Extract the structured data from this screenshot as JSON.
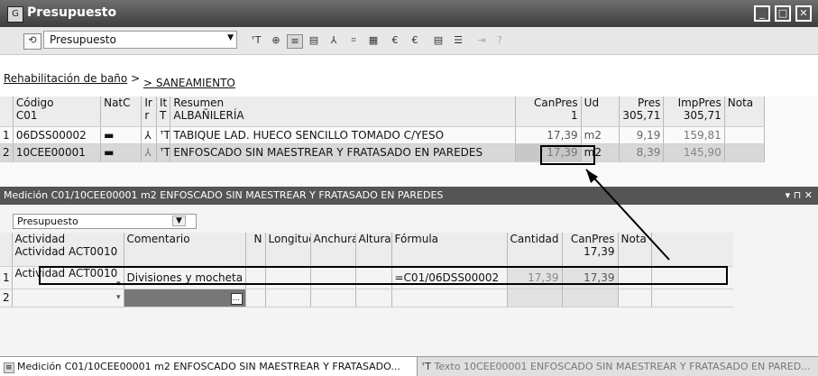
{
  "window": {
    "title": "Presupuesto",
    "app_icon": "G"
  },
  "toolbar": {
    "view_select": "Presupuesto"
  },
  "breadcrumb": {
    "root": "Rehabilitación de baño",
    "sep": ">",
    "current": "> SANEAMIENTO"
  },
  "upper_table": {
    "headers": {
      "codigo": "Código",
      "codigo_sub": "C01",
      "natc": "NatC",
      "ir": "Ir",
      "ir_sub": "r",
      "it": "It",
      "it_sub": "T",
      "resumen": "Resumen",
      "resumen_sub": "ALBAÑILERÍA",
      "canpres": "CanPres",
      "canpres_sub": "1",
      "ud": "Ud",
      "pres": "Pres",
      "pres_sub": "305,71",
      "imppres": "ImpPres",
      "imppres_sub": "305,71",
      "nota": "Nota"
    },
    "rows": [
      {
        "num": "1",
        "codigo": "06DSS00002",
        "resumen": "TABIQUE LAD. HUECO SENCILLO TOMADO C/YESO",
        "canpres": "17,39",
        "ud": "m2",
        "pres": "9,19",
        "imppres": "159,81"
      },
      {
        "num": "2",
        "codigo": "10CEE00001",
        "resumen": "ENFOSCADO SIN MAESTREAR Y FRATASADO EN PAREDES",
        "canpres": "17,39",
        "ud": "m2",
        "pres": "8,39",
        "imppres": "145,90"
      }
    ]
  },
  "panel": {
    "title": "Medición C01/10CEE00001 m2 ENFOSCADO SIN MAESTREAR Y FRATASADO EN PAREDES",
    "pin": "▾ ⊓ ✕"
  },
  "lower": {
    "select": "Presupuesto",
    "headers": {
      "actividad": "Actividad",
      "actividad_sub": "Actividad ACT0010",
      "comentario": "Comentario",
      "n": "N",
      "longitud": "Longitud",
      "anchura": "Anchura",
      "altura": "Altura",
      "formula": "Fórmula",
      "cantidad": "Cantidad",
      "canpres": "CanPres",
      "canpres_sub": "17,39",
      "nota": "Nota"
    },
    "rows": [
      {
        "num": "1",
        "actividad": "Actividad ACT0010",
        "comentario": "Divisiones y mocheta",
        "formula": "=C01/06DSS00002",
        "cantidad": "17,39",
        "canpres": "17,39"
      },
      {
        "num": "2",
        "actividad": "",
        "comentario": "",
        "formula": "",
        "cantidad": "",
        "canpres": ""
      }
    ]
  },
  "bottom_tabs": {
    "tab1": "Medición C01/10CEE00001 m2 ENFOSCADO SIN MAESTREAR Y FRATASADO...",
    "tab2": "Texto 10CEE00001 ENFOSCADO SIN MAESTREAR Y FRATASADO EN PARED..."
  }
}
